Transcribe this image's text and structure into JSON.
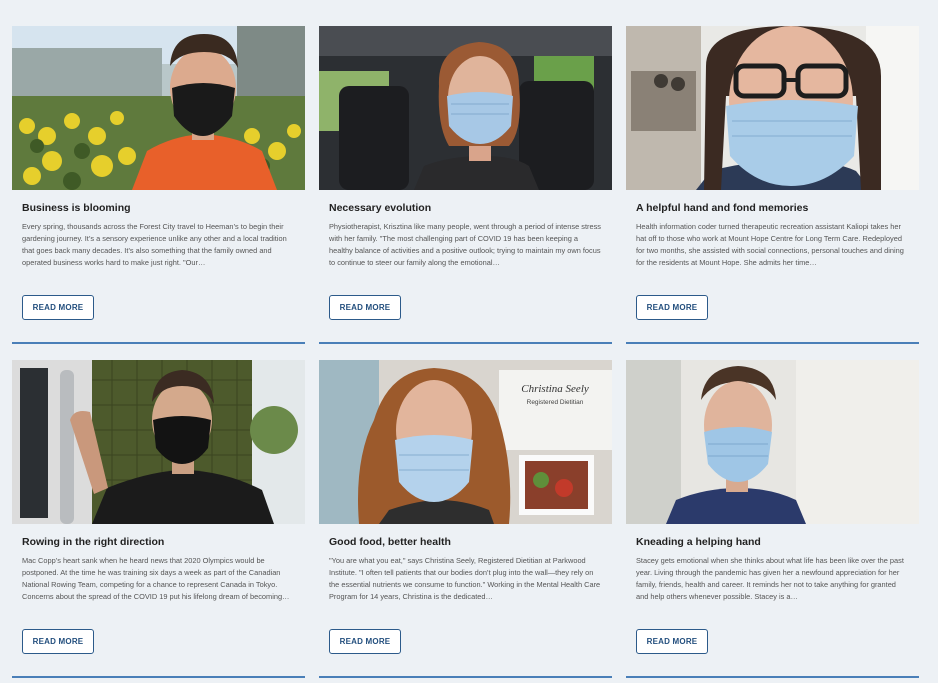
{
  "cards": [
    {
      "title": "Business is blooming",
      "excerpt": "Every spring, thousands across the Forest City travel to Heeman’s to begin their gardening journey. It’s a sensory experience unlike any other and a local tradition that goes back many decades. It’s also something that the family owned and operated business works hard to make just right. \"Our…",
      "button": "READ MORE",
      "image": "man-in-black-mask-at-greenhouse"
    },
    {
      "title": "Necessary evolution",
      "excerpt": "Physiotherapist, Krisztina like many people, went through a period of intense stress with her family. \"The most challenging part of COVID 19 has been keeping a healthy balance of activities and a positive outlook; trying to maintain my own focus to continue to steer our family along the emotional…",
      "button": "READ MORE",
      "image": "woman-in-blue-mask-in-car"
    },
    {
      "title": "A helpful hand and fond memories",
      "excerpt": "Health information coder turned therapeutic recreation assistant Kaliopi takes her hat off to those who work at Mount Hope Centre for Long Term Care. Redeployed for two months, she assisted with social connections, personal touches and dining for the residents at Mount Hope. She admits her time…",
      "button": "READ MORE",
      "image": "woman-with-glasses-in-blue-mask"
    },
    {
      "title": "Rowing in the right direction",
      "excerpt": "Mac Copp’s heart sank when he heard news that 2020 Olympics would be postponed. At the time he was training six days a week as part of the Canadian National Rowing Team, competing for a chance to represent Canada in Tokyo. Concerns about the spread of the COVID 19 put his lifelong dream of becoming…",
      "button": "READ MORE",
      "image": "man-in-black-mask-at-doorway"
    },
    {
      "title": "Good food, better health",
      "excerpt": "\"You are what you eat,\" says Christina Seely, Registered Dietitian at Parkwood Institute. \"I often tell patients that our bodies don’t plug into the wall—they rely on the essential nutrients we consume to function.\" Working in the Mental Health Care Program for 14 years, Christina is the dedicated…",
      "button": "READ MORE",
      "image": "woman-with-curly-hair-in-blue-mask",
      "sign": {
        "name": "Christina Seely",
        "role": "Registered Dietitian"
      }
    },
    {
      "title": "Kneading a helping hand",
      "excerpt": "Stacey gets emotional when she thinks about what life has been like over the past year. Living through the pandemic has given her a newfound appreciation for her family, friends, health and career. It reminds her not to take anything for granted and help others whenever possible. Stacey is a…",
      "button": "READ MORE",
      "image": "woman-in-scrubs-in-blue-mask"
    }
  ]
}
